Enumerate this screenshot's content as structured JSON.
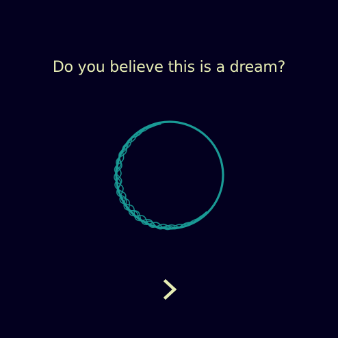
{
  "prompt": {
    "question": "Do you believe this is a dream?"
  },
  "orb": {
    "icon": "woven-ring-icon",
    "color": "#1a9a95"
  },
  "navigation": {
    "next_icon": "chevron-right-icon",
    "next_color": "#e6ecb4"
  },
  "theme": {
    "background": "#03001f",
    "text": "#e6ecb4"
  }
}
